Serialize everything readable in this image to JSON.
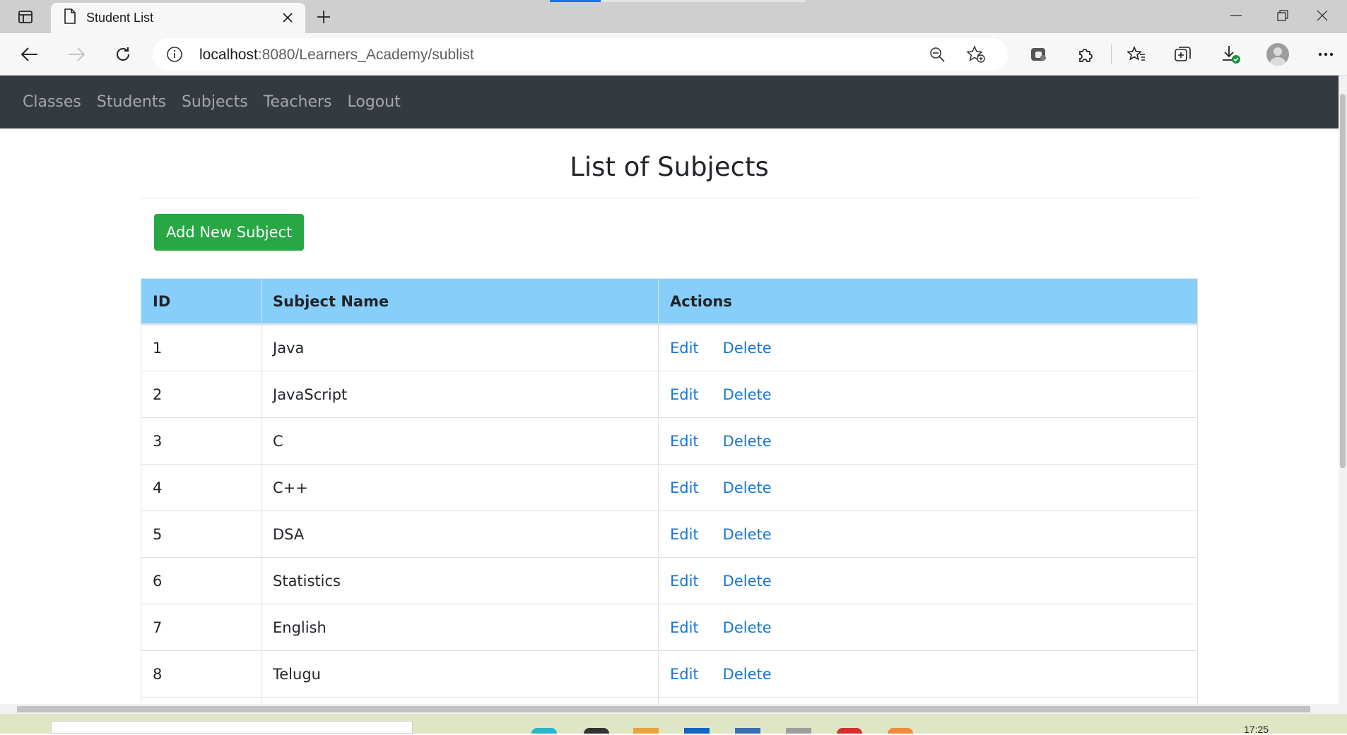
{
  "browser": {
    "tab_title": "Student List",
    "url_host": "localhost",
    "url_path": ":8080/Learners_Academy/sublist"
  },
  "nav": {
    "links": [
      "Classes",
      "Students",
      "Subjects",
      "Teachers",
      "Logout"
    ]
  },
  "page": {
    "title": "List of Subjects",
    "add_button": "Add New Subject"
  },
  "table": {
    "headers": [
      "ID",
      "Subject Name",
      "Actions"
    ],
    "edit_label": "Edit",
    "delete_label": "Delete",
    "rows": [
      {
        "id": "1",
        "name": "Java"
      },
      {
        "id": "2",
        "name": "JavaScript"
      },
      {
        "id": "3",
        "name": "C"
      },
      {
        "id": "4",
        "name": "C++"
      },
      {
        "id": "5",
        "name": "DSA"
      },
      {
        "id": "6",
        "name": "Statistics"
      },
      {
        "id": "7",
        "name": "English"
      },
      {
        "id": "8",
        "name": "Telugu"
      }
    ]
  },
  "taskbar": {
    "clock": "17:25"
  },
  "colors": {
    "navbar": "#343a40",
    "table_header": "#87cefa",
    "add_button": "#28a745",
    "action_link": "#1976d2"
  }
}
